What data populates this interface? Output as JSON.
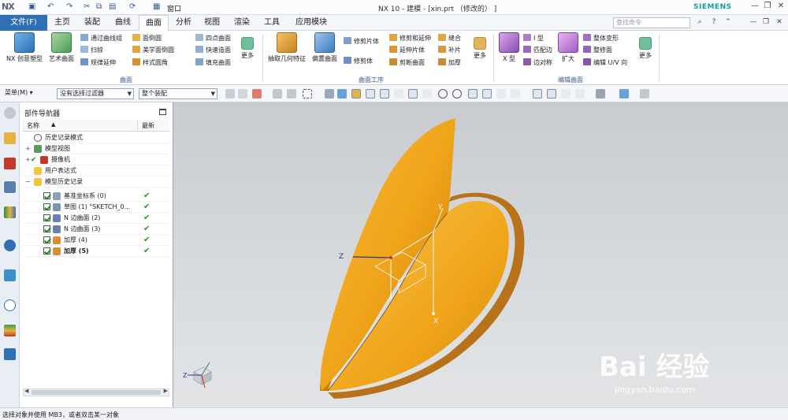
{
  "app": {
    "logo": "NX",
    "title": "NX 10 - 建模 - [xin.prt （修改的） ]",
    "brand": "SIEMENS",
    "window_menu": "窗口",
    "search_placeholder": "查找命令"
  },
  "tabs": {
    "file": "文件(F)",
    "items": [
      "主页",
      "装配",
      "曲线",
      "曲面",
      "分析",
      "视图",
      "渲染",
      "工具",
      "应用模块"
    ],
    "active": "曲面"
  },
  "ribbon": {
    "group1": {
      "label": "曲面",
      "big": [
        "NX 创意塑型",
        "艺术曲面",
        "更多"
      ],
      "small": [
        "通过曲线组",
        "扫掠",
        "规律延伸",
        "面倒圆",
        "美学面倒圆",
        "样式圆角",
        "四点曲面",
        "快速造面",
        "填充曲面"
      ]
    },
    "group2": {
      "label": "曲面工序",
      "big": [
        "抽取几何特征",
        "偏置曲面",
        "更多"
      ],
      "small": [
        "修剪片体",
        "修剪体",
        "修剪和延伸",
        "延伸片体",
        "剪断曲面",
        "缝合",
        "补片",
        "加厚"
      ]
    },
    "group3": {
      "label": "编辑曲面",
      "big": [
        "X 型",
        "扩大",
        "更多"
      ],
      "small": [
        "I 型",
        "匹配边",
        "边对称",
        "整体变形",
        "整修面",
        "编辑 U/V 向"
      ]
    }
  },
  "selection": {
    "menu": "菜单(M) ▾",
    "filter": "没有选择过滤器",
    "scope": "整个装配"
  },
  "navigator": {
    "title": "部件导航器",
    "col_name": "名称",
    "col_latest": "最新",
    "rows": [
      {
        "label": "历史记录模式",
        "level": 0,
        "check": false,
        "ok": false,
        "bold": false
      },
      {
        "label": "模型视图",
        "level": 0,
        "check": false,
        "ok": false,
        "bold": false
      },
      {
        "label": "摄像机",
        "level": 0,
        "check": false,
        "ok": false,
        "bold": false
      },
      {
        "label": "用户表达式",
        "level": 0,
        "check": false,
        "ok": false,
        "bold": false
      },
      {
        "label": "模型历史记录",
        "level": 0,
        "check": false,
        "ok": false,
        "bold": false
      },
      {
        "label": "基准坐标系 (0)",
        "level": 1,
        "check": true,
        "ok": true,
        "bold": false
      },
      {
        "label": "草图 (1) \"SKETCH_0...",
        "level": 1,
        "check": true,
        "ok": true,
        "bold": false
      },
      {
        "label": "N 边曲面 (2)",
        "level": 1,
        "check": true,
        "ok": true,
        "bold": false
      },
      {
        "label": "N 边曲面 (3)",
        "level": 1,
        "check": true,
        "ok": true,
        "bold": false
      },
      {
        "label": "加厚 (4)",
        "level": 1,
        "check": true,
        "ok": true,
        "bold": false
      },
      {
        "label": "加厚 (5)",
        "level": 1,
        "check": true,
        "ok": true,
        "bold": true
      }
    ]
  },
  "viewport": {
    "axes": {
      "x": "X",
      "y": "Y",
      "z": "Z"
    },
    "model_color": "#f0a51a"
  },
  "status": {
    "text": "选择对象并使用 MB3，或者双击某一对象"
  },
  "watermark": {
    "main": "Bai 经验",
    "sub": "jingyan.baidu.com"
  }
}
